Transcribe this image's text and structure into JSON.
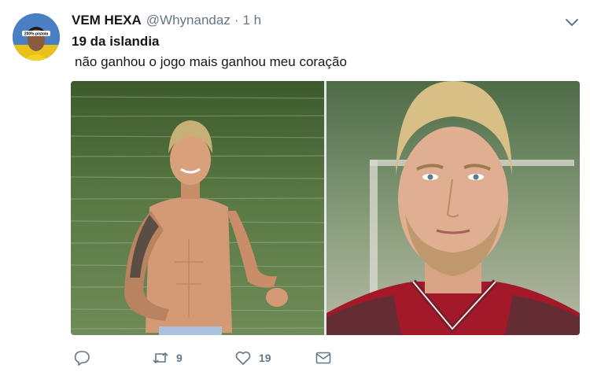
{
  "tweet": {
    "display_name": "VEM HEXA",
    "handle": "@Whynandaz",
    "separator": "·",
    "time": "1 h",
    "text_line1": "19 da islandia",
    "text_line2": "não ganhou o jogo mais ganhou meu coração",
    "avatar_badge": "200% pistola"
  },
  "actions": {
    "reply_icon": "reply-icon",
    "retweet_icon": "retweet-icon",
    "retweet_count": "9",
    "like_icon": "heart-icon",
    "like_count": "19",
    "dm_icon": "envelope-icon"
  },
  "colors": {
    "text": "#14171a",
    "muted": "#657786",
    "water": "#4f6b3c",
    "jersey": "#a3192a"
  }
}
